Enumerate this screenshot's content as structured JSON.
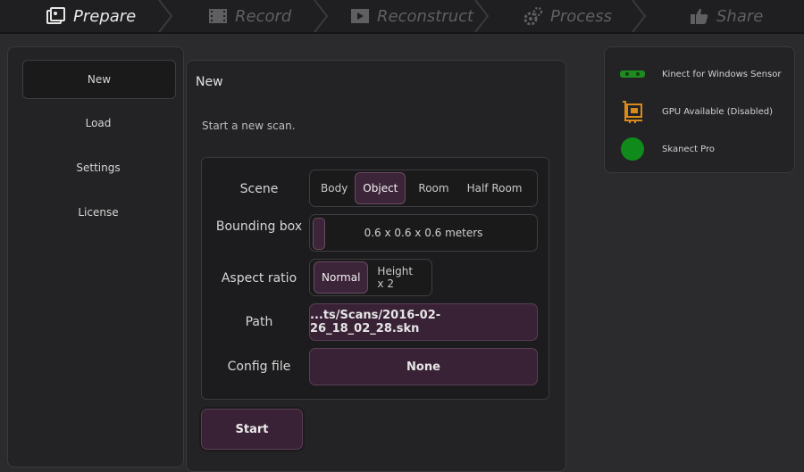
{
  "wizard": {
    "steps": [
      {
        "label": "Prepare",
        "icon": "photo-stack-icon",
        "active": true
      },
      {
        "label": "Record",
        "icon": "film-icon",
        "active": false
      },
      {
        "label": "Reconstruct",
        "icon": "film-play-icon",
        "active": false
      },
      {
        "label": "Process",
        "icon": "gears-icon",
        "active": false
      },
      {
        "label": "Share",
        "icon": "thumbs-up-icon",
        "active": false
      }
    ]
  },
  "sidebar": {
    "items": [
      {
        "label": "New",
        "selected": true
      },
      {
        "label": "Load",
        "selected": false
      },
      {
        "label": "Settings",
        "selected": false
      },
      {
        "label": "License",
        "selected": false
      }
    ]
  },
  "main": {
    "title": "New",
    "subtitle": "Start a new scan.",
    "form": {
      "scene": {
        "label": "Scene",
        "options": [
          "Body",
          "Object",
          "Room",
          "Half Room"
        ],
        "selected": "Object"
      },
      "bounding_box": {
        "label": "Bounding box",
        "value": "0.6 x 0.6 x 0.6 meters"
      },
      "aspect_ratio": {
        "label": "Aspect ratio",
        "options": [
          "Normal",
          "Height x 2"
        ],
        "selected": "Normal"
      },
      "path": {
        "label": "Path",
        "value": "...ts/Scans/2016-02-26_18_02_28.skn"
      },
      "config_file": {
        "label": "Config file",
        "value": "None"
      }
    },
    "start_label": "Start"
  },
  "status": {
    "items": [
      {
        "icon": "kinect-sensor-icon",
        "text": "Kinect for Windows Sensor"
      },
      {
        "icon": "gpu-card-icon",
        "text": "GPU Available (Disabled)"
      },
      {
        "icon": "green-status-dot-icon",
        "text": "Skanect Pro"
      }
    ]
  },
  "colors": {
    "accent_purple": "#3a2236",
    "status_green": "#1f8a1f",
    "gpu_orange": "#d98a1a"
  }
}
